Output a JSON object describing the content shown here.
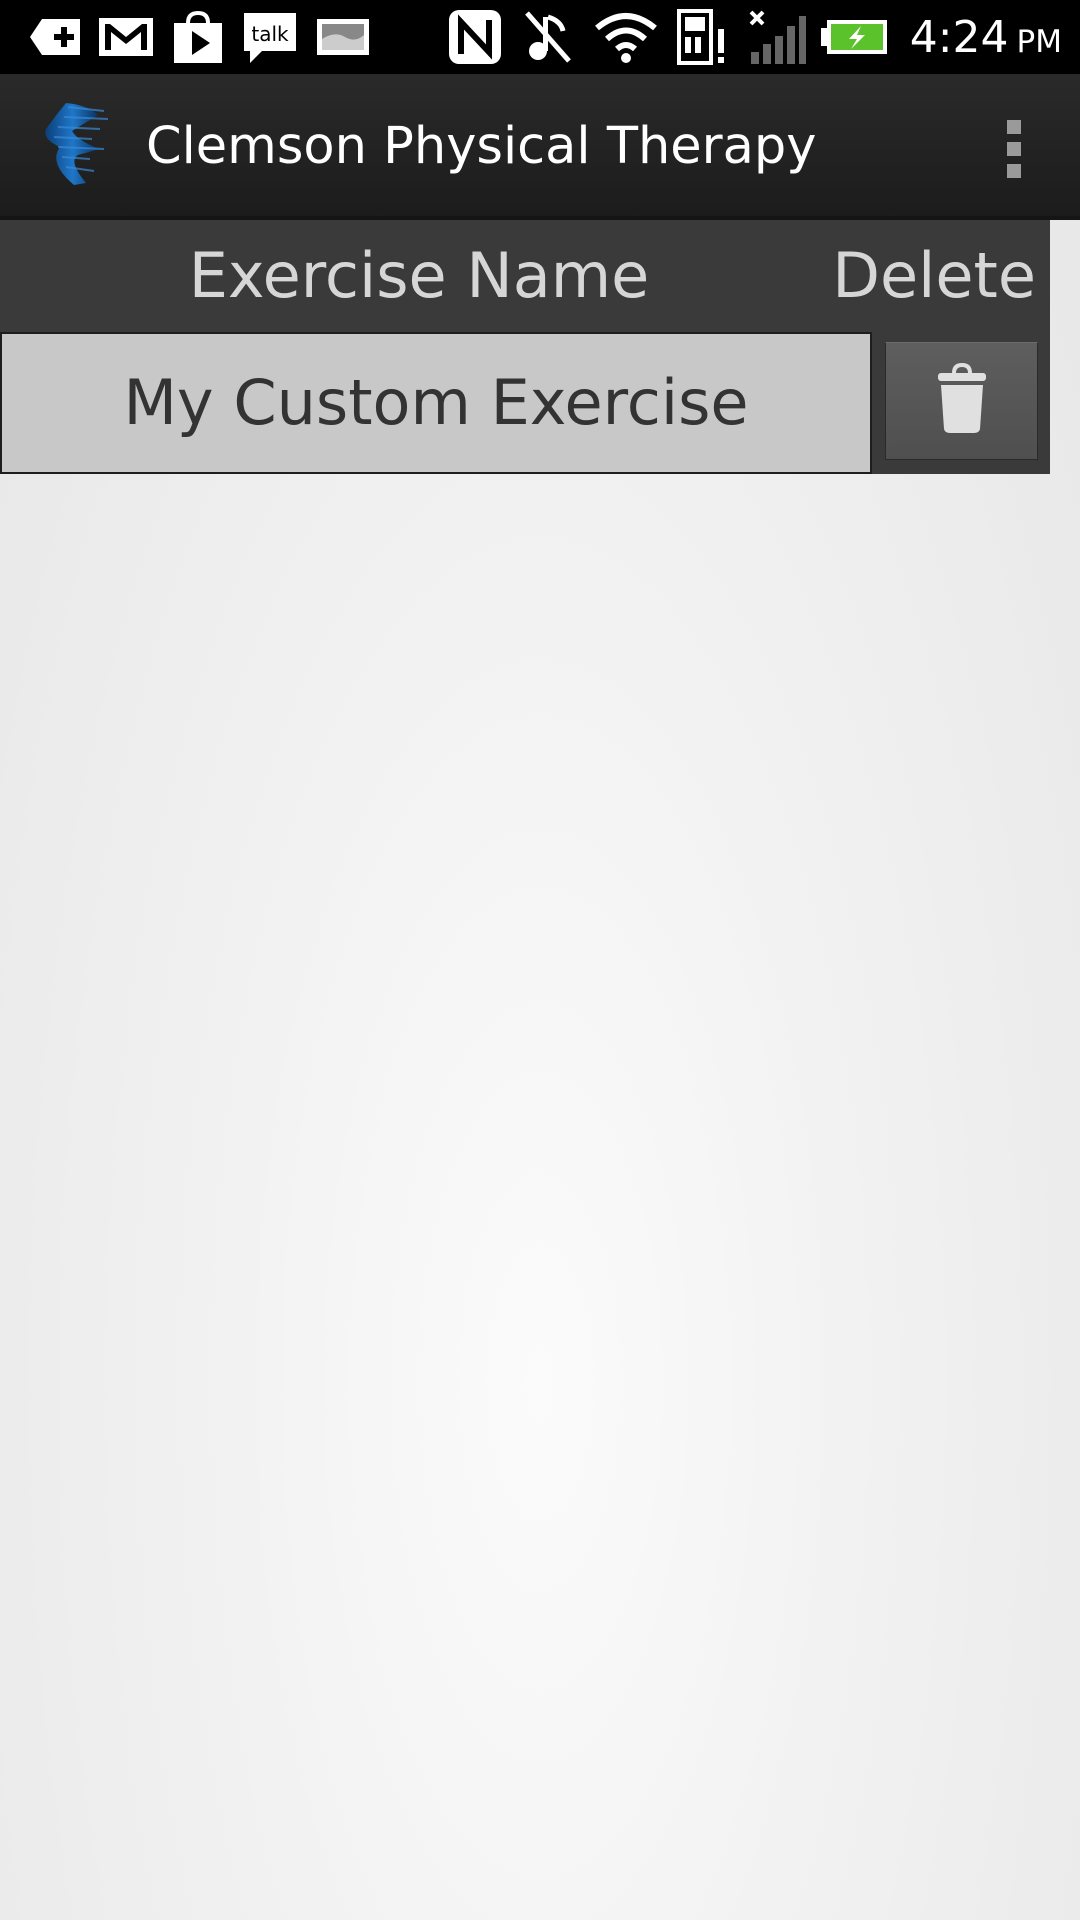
{
  "status_bar": {
    "time": "4:24",
    "ampm": "PM",
    "icons": [
      "google-plus-icon",
      "gmail-icon",
      "play-store-icon",
      "talk-icon",
      "image-icon",
      "nfc-icon",
      "music-muted-icon",
      "wifi-icon",
      "sd-card-warning-icon",
      "signal-icon",
      "battery-charging-icon"
    ],
    "battery_color": "#5cc22c"
  },
  "action_bar": {
    "title": "Clemson Physical Therapy",
    "logo": "runner-logo-icon",
    "menu_icon": "overflow-menu-icon"
  },
  "table": {
    "headers": {
      "name": "Exercise Name",
      "delete": "Delete"
    },
    "rows": [
      {
        "name": "My Custom Exercise",
        "delete_icon": "trash-icon"
      }
    ]
  },
  "colors": {
    "action_bar": "#222222",
    "table_header": "#3a3a3a",
    "row_bg": "#c8c8c8",
    "logo_blue": "#1f6fc0"
  }
}
